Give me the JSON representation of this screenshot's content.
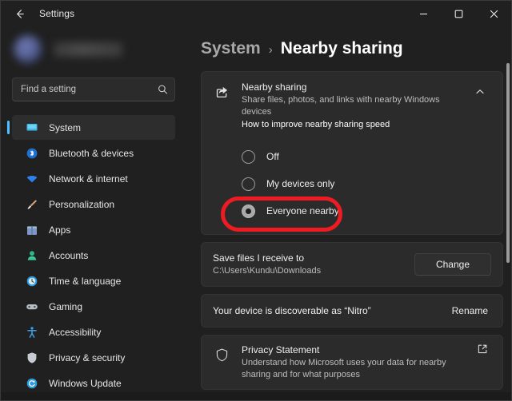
{
  "window": {
    "title": "Settings",
    "back_icon": "back-arrow-icon",
    "controls": {
      "minimize": "minimize-icon",
      "maximize": "maximize-icon",
      "close": "close-icon"
    }
  },
  "sidebar": {
    "profile": {
      "avatar": "user-avatar-blurred",
      "name": ""
    },
    "search": {
      "placeholder": "Find a setting",
      "value": "",
      "icon": "search-icon"
    },
    "items": [
      {
        "label": "System",
        "icon": "monitor-icon",
        "color": "#4cc2ff",
        "selected": true
      },
      {
        "label": "Bluetooth & devices",
        "icon": "bluetooth-icon",
        "color": "#2f80ed",
        "selected": false
      },
      {
        "label": "Network & internet",
        "icon": "wifi-icon",
        "color": "#2f80ed",
        "selected": false
      },
      {
        "label": "Personalization",
        "icon": "paintbrush-icon",
        "color": "#d9a066",
        "selected": false
      },
      {
        "label": "Apps",
        "icon": "apps-icon",
        "color": "#6f93c9",
        "selected": false
      },
      {
        "label": "Accounts",
        "icon": "person-icon",
        "color": "#37b98a",
        "selected": false
      },
      {
        "label": "Time & language",
        "icon": "clock-icon",
        "color": "#2f9bd8",
        "selected": false
      },
      {
        "label": "Gaming",
        "icon": "gamepad-icon",
        "color": "#b9bfc6",
        "selected": false
      },
      {
        "label": "Accessibility",
        "icon": "accessibility-icon",
        "color": "#3b9ae1",
        "selected": false
      },
      {
        "label": "Privacy & security",
        "icon": "shield-icon",
        "color": "#c9cdd2",
        "selected": false
      },
      {
        "label": "Windows Update",
        "icon": "update-icon",
        "color": "#2f9bd8",
        "selected": false
      }
    ]
  },
  "breadcrumb": {
    "parent": "System",
    "separator": "›",
    "current": "Nearby sharing"
  },
  "nearby_sharing": {
    "icon": "share-icon",
    "title": "Nearby sharing",
    "subtitle": "Share files, photos, and links with nearby Windows devices",
    "link": "How to improve nearby sharing speed",
    "expand_icon": "chevron-up-icon",
    "options": [
      {
        "label": "Off",
        "selected": false
      },
      {
        "label": "My devices only",
        "selected": false
      },
      {
        "label": "Everyone nearby",
        "selected": true
      }
    ]
  },
  "save_location": {
    "title": "Save files I receive to",
    "path": "C:\\Users\\Kundu\\Downloads",
    "button": "Change"
  },
  "device_name": {
    "text": "Your device is discoverable as “Nitro”",
    "action": "Rename"
  },
  "privacy": {
    "icon": "shield-icon",
    "title": "Privacy Statement",
    "subtitle": "Understand how Microsoft uses your data for nearby sharing and for what purposes",
    "external_icon": "external-link-icon"
  },
  "annotation": {
    "color": "#ee1c22",
    "target": "Everyone nearby"
  }
}
